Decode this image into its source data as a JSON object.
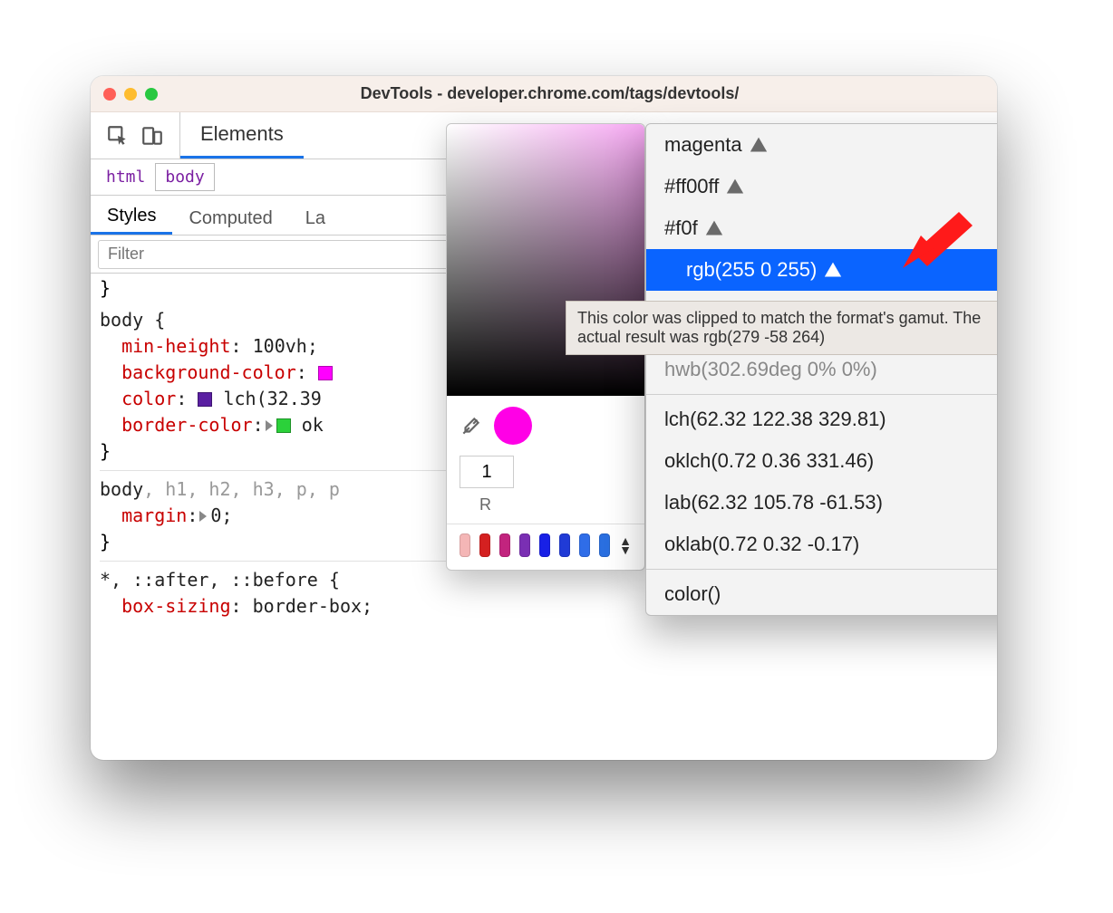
{
  "window": {
    "title": "DevTools - developer.chrome.com/tags/devtools/"
  },
  "tabs": {
    "elements": "Elements"
  },
  "breadcrumbs": [
    "html",
    "body"
  ],
  "subtabs": {
    "styles": "Styles",
    "computed": "Computed",
    "layout_frag": "La"
  },
  "filter": {
    "placeholder": "Filter"
  },
  "css": {
    "close0": "}",
    "body_sel": "body {",
    "min_height_k": "min-height",
    "min_height_v": "100vh;",
    "bg_k": "background-color",
    "bg_after": ":",
    "color_k": "color",
    "color_v_fn": "lch(32.39 ",
    "border_k": "border-color",
    "border_v_frag": "ok",
    "close1": "}",
    "multi_sel_a": "body",
    "multi_sel_rest": ", h1, h2, h3, p, p",
    "margin_k": "margin",
    "margin_v": "0;",
    "close2": "}",
    "star_sel": "*, ::after, ::before {",
    "boxs_k": "box-sizing",
    "boxs_v": "border-box;"
  },
  "picker": {
    "one": "1",
    "channel": "R"
  },
  "palette": [
    "#f4b6b6",
    "#d42020",
    "#c2247e",
    "#7a2fb3",
    "#1820e6",
    "#203bd6",
    "#2f6de8",
    "#2a6fe0"
  ],
  "format_menu": {
    "items_warn": [
      "magenta",
      "#ff00ff",
      "#f0f",
      "rgb(255 0 255)"
    ],
    "selected_index": 3,
    "hidden_item_right": "%)",
    "hwb": "hwb(302.69deg 0% 0%)",
    "items_plain": [
      "lch(62.32 122.38 329.81)",
      "oklch(0.72 0.36 331.46)",
      "lab(62.32 105.78 -61.53)",
      "oklab(0.72 0.32 -0.17)"
    ],
    "color_fn": "color()"
  },
  "tooltip": "This color was clipped to match the format's gamut. The actual result was rgb(279 -58 264)"
}
